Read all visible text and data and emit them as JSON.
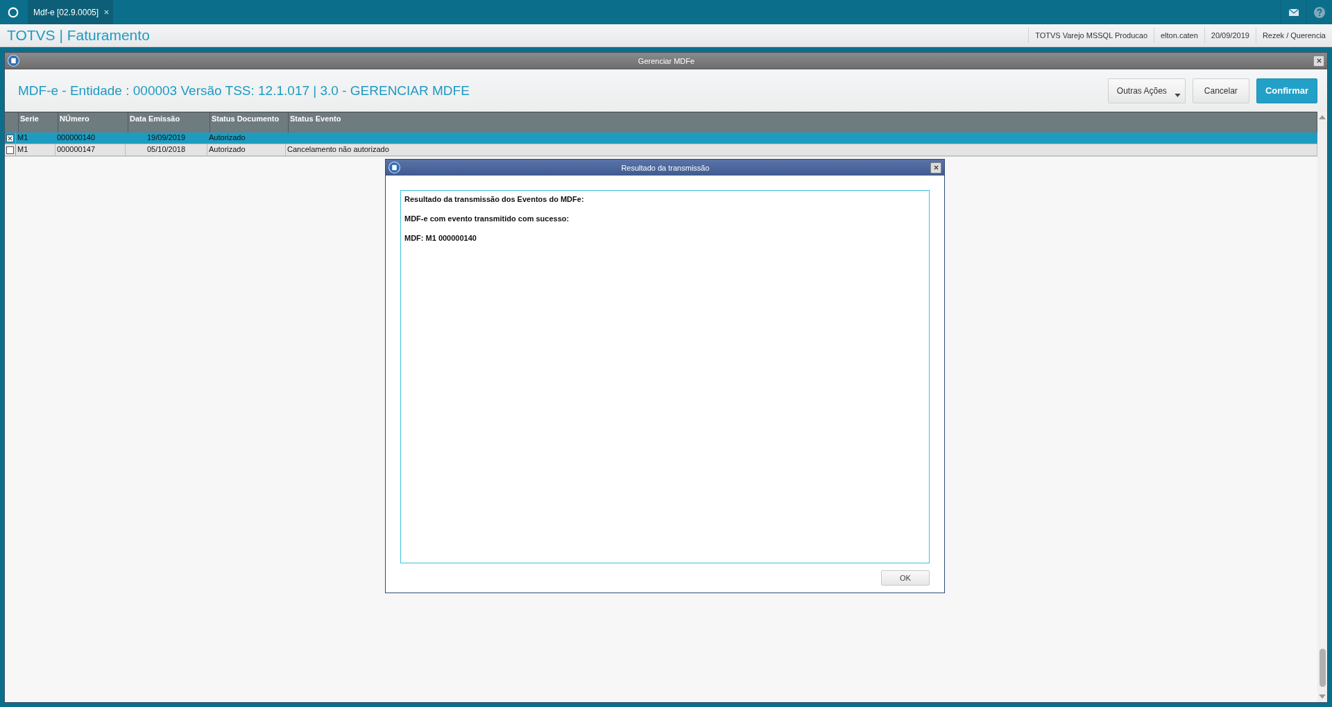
{
  "app_tab": {
    "label": "Mdf-e [02.9.0005]",
    "selected": true
  },
  "header": {
    "title": "TOTVS | Faturamento",
    "info": [
      "TOTVS Varejo MSSQL Producao",
      "elton.caten",
      "20/09/2019",
      "Rezek / Querencia"
    ]
  },
  "window": {
    "title": "Gerenciar MDFe",
    "heading": "MDF-e - Entidade : 000003 Versão TSS: 12.1.017 | 3.0 - GERENCIAR MDFE",
    "buttons": [
      {
        "label": "Outras Ações",
        "kind": "menu"
      },
      {
        "label": "Cancelar",
        "kind": "default"
      },
      {
        "label": "Confirmar",
        "kind": "primary"
      }
    ]
  },
  "table": {
    "columns": [
      "Serie",
      "NÚmero",
      "Data Emissão",
      "Status Documento",
      "Status Evento"
    ],
    "rows": [
      {
        "checked": true,
        "selected": true,
        "cells": [
          "M1",
          "000000140",
          "19/09/2019",
          "Autorizado"
        ]
      },
      {
        "checked": false,
        "selected": false,
        "cells": [
          "M1",
          "000000147",
          "05/10/2018",
          "Autorizado",
          "Cancelamento não autorizado"
        ]
      }
    ]
  },
  "dialog": {
    "title": "Resultado da transmissão",
    "lines": [
      "Resultado da transmissão dos Eventos do MDFe:",
      "MDF-e com evento transmitido com sucesso:",
      "MDF: M1 000000140"
    ],
    "button": "OK"
  }
}
